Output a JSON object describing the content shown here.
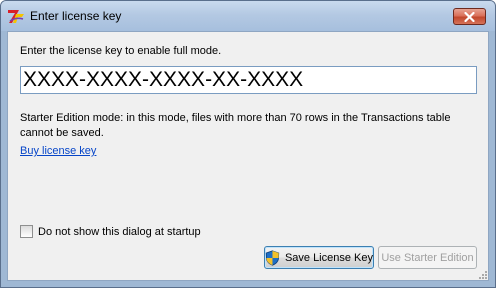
{
  "window": {
    "title": "Enter license key"
  },
  "dialog": {
    "instruction": "Enter the license key to enable full mode.",
    "license_key_value": "XXXX-XXXX-XXXX-XX-XXXX",
    "mode_description": "Starter Edition mode: in this mode, files with more than 70 rows in the Transactions table cannot be saved.",
    "buy_link": "Buy license key",
    "startup_checkbox_label": "Do not show this dialog at startup",
    "startup_checkbox_checked": false
  },
  "buttons": {
    "save_label": "Save License Key",
    "starter_label": "Use Starter Edition",
    "starter_enabled": false
  },
  "icons": {
    "app": "app-logo-icon",
    "close": "close-icon",
    "shield": "shield-icon"
  },
  "colors": {
    "link": "#0645c8",
    "close_button": "#c2482d",
    "title_bar": "#b4c9e3"
  }
}
